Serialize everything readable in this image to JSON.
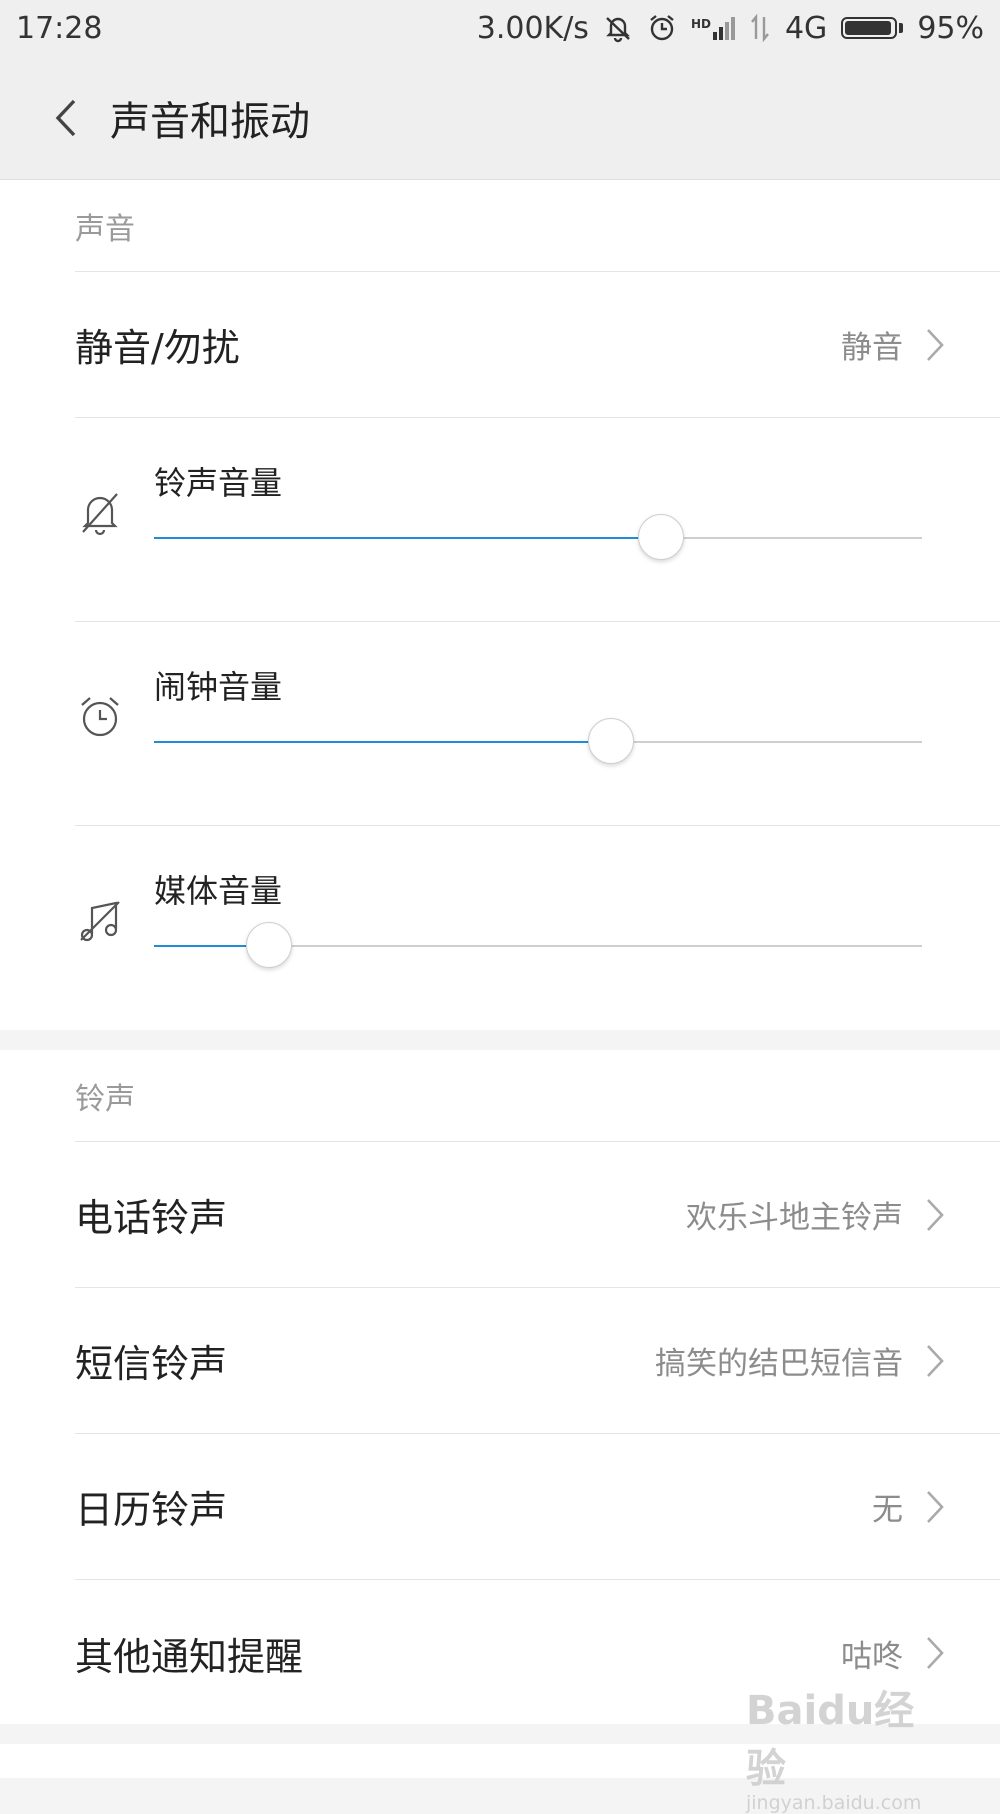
{
  "status_bar": {
    "time": "17:28",
    "net_speed": "3.00K/s",
    "network": "4G",
    "battery": "95%",
    "battery_level": 0.95,
    "hd_badge": "HD",
    "icons": [
      "mute-bell-icon",
      "alarm-icon",
      "signal-icon",
      "data-arrows-icon",
      "battery-icon"
    ]
  },
  "header": {
    "title": "声音和振动"
  },
  "sound_section": {
    "title": "声音",
    "dnd": {
      "label": "静音/勿扰",
      "value": "静音"
    },
    "volumes": [
      {
        "label": "铃声音量",
        "level": 0.66,
        "icon": "muted-bell-icon"
      },
      {
        "label": "闹钟音量",
        "level": 0.595,
        "icon": "alarm-clock-icon"
      },
      {
        "label": "媒体音量",
        "level": 0.15,
        "icon": "muted-music-icon"
      }
    ]
  },
  "ringtone_section": {
    "title": "铃声",
    "items": [
      {
        "label": "电话铃声",
        "value": "欢乐斗地主铃声"
      },
      {
        "label": "短信铃声",
        "value": "搞笑的结巴短信音"
      },
      {
        "label": "日历铃声",
        "value": "无"
      },
      {
        "label": "其他通知提醒",
        "value": "咕咚"
      }
    ]
  },
  "watermark": {
    "main": "Baidu经验",
    "sub": "jingyan.baidu.com"
  },
  "colors": {
    "accent": "#1e8fd6",
    "track": "#cfcfcf",
    "bg": "#f4f4f4",
    "card": "#ffffff"
  }
}
